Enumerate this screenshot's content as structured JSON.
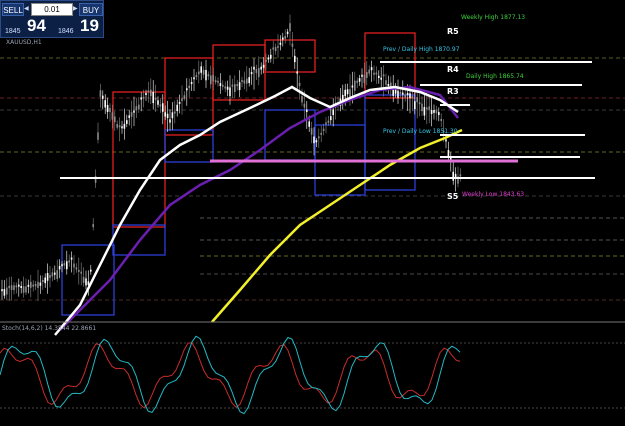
{
  "trade_panel": {
    "sell_label": "SELL",
    "buy_label": "BUY",
    "lot_size": "0.01",
    "sell_price_small": "1845",
    "sell_price_big": "94",
    "buy_price_small": "1846",
    "buy_price_big": "19"
  },
  "symbol_label": "XAUUSD,H1",
  "levels": {
    "weekly_high": "Weekly High 1877.13",
    "prev_day_high": "Prev / Daily High 1870.97",
    "daily_high": "Daily High 1865.74",
    "prev_day_low": "Prev / Daily Low 1851.30",
    "weekly_low": "Weekly Low 1843.63"
  },
  "pivots": {
    "r5": "R5",
    "r4": "R4",
    "r3": "R3",
    "s5": "S5"
  },
  "stoch_label": "Stoch(14,6,2) 14.3544 22.8661",
  "colors": {
    "background": "#000000",
    "bull_candle": "#ffffff",
    "bear_candle": "#8c8c8c",
    "ma_fast": "#ffffff",
    "ma_mid": "#6a1fb0",
    "ma_slow": "#f2ef2b",
    "weekly_box": "#e0201e",
    "daily_box": "#2c3fd6",
    "stoch_main": "#22b9c4",
    "stoch_signal": "#c62c2c",
    "weekly_high_text": "#3fd23f",
    "prev_day_text": "#36c8e8",
    "weekly_low_text": "#e040d0"
  }
}
